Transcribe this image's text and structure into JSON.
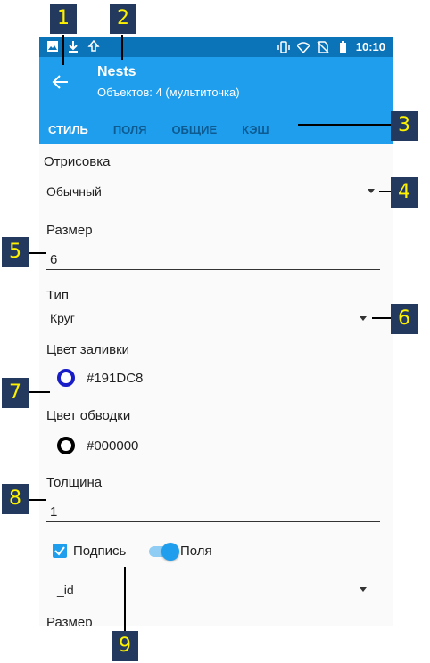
{
  "status": {
    "time": "10:10"
  },
  "header": {
    "title": "Nests",
    "subtitle": "Объектов: 4 (мультиточка)"
  },
  "tabs": [
    "СТИЛЬ",
    "ПОЛЯ",
    "ОБЩИЕ",
    "КЭШ"
  ],
  "form": {
    "render_label": "Отрисовка",
    "render_value": "Обычный",
    "size_label": "Размер",
    "size_value": "6",
    "type_label": "Тип",
    "type_value": "Круг",
    "fill_label": "Цвет заливки",
    "fill_value": "#191DC8",
    "stroke_label": "Цвет обводки",
    "stroke_value": "#000000",
    "thickness_label": "Толщина",
    "thickness_value": "1",
    "caption_label": "Подпись",
    "fields_label": "Поля",
    "field_value": "_id",
    "size2_label": "Размер"
  },
  "callouts": [
    "1",
    "2",
    "3",
    "4",
    "5",
    "6",
    "7",
    "8",
    "9"
  ],
  "colors": {
    "appbar": "#1e9eec",
    "statusbar": "#0b73b8",
    "fill": "#191DC8",
    "stroke": "#000000",
    "callout_bg": "#233a5e",
    "callout_text": "#fff200"
  }
}
